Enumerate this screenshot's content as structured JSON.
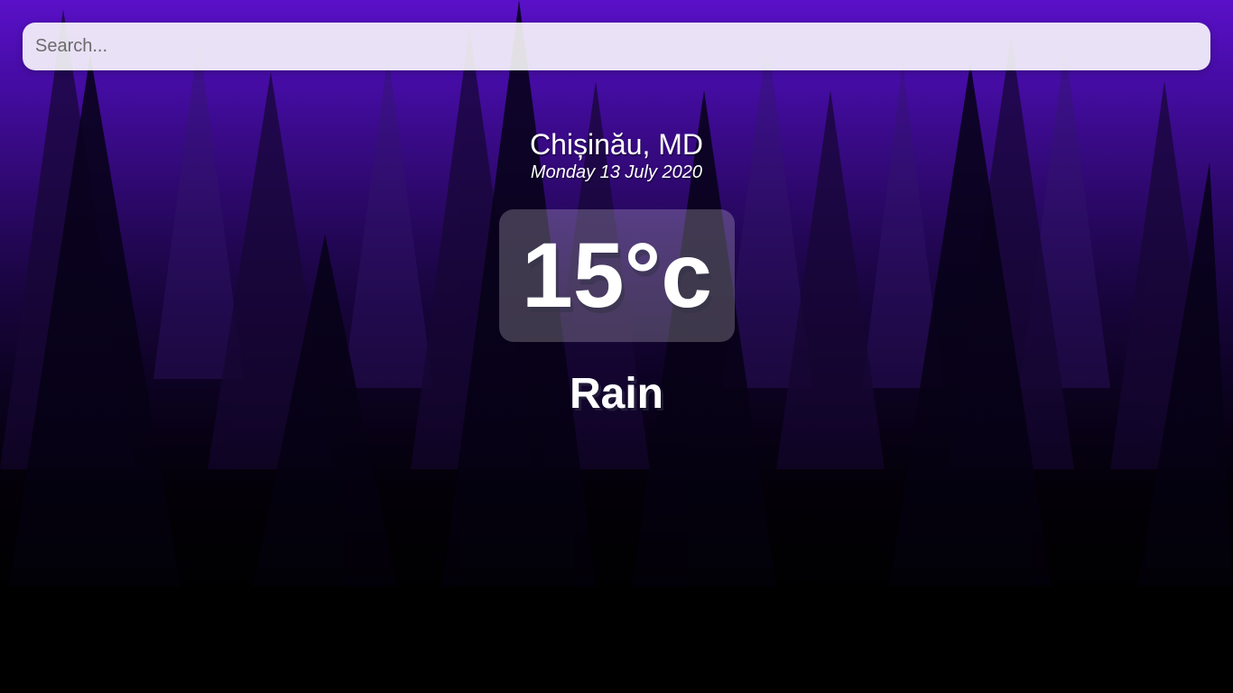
{
  "search": {
    "placeholder": "Search...",
    "value": ""
  },
  "location": {
    "city": "Chișinău, MD",
    "date": "Monday 13 July 2020"
  },
  "temperature": {
    "display": "15°c"
  },
  "weather": {
    "condition": "Rain"
  },
  "colors": {
    "sky_top": "#5a10c8",
    "sky_mid": "#24075a",
    "ground": "#000000",
    "text": "#ffffff"
  }
}
